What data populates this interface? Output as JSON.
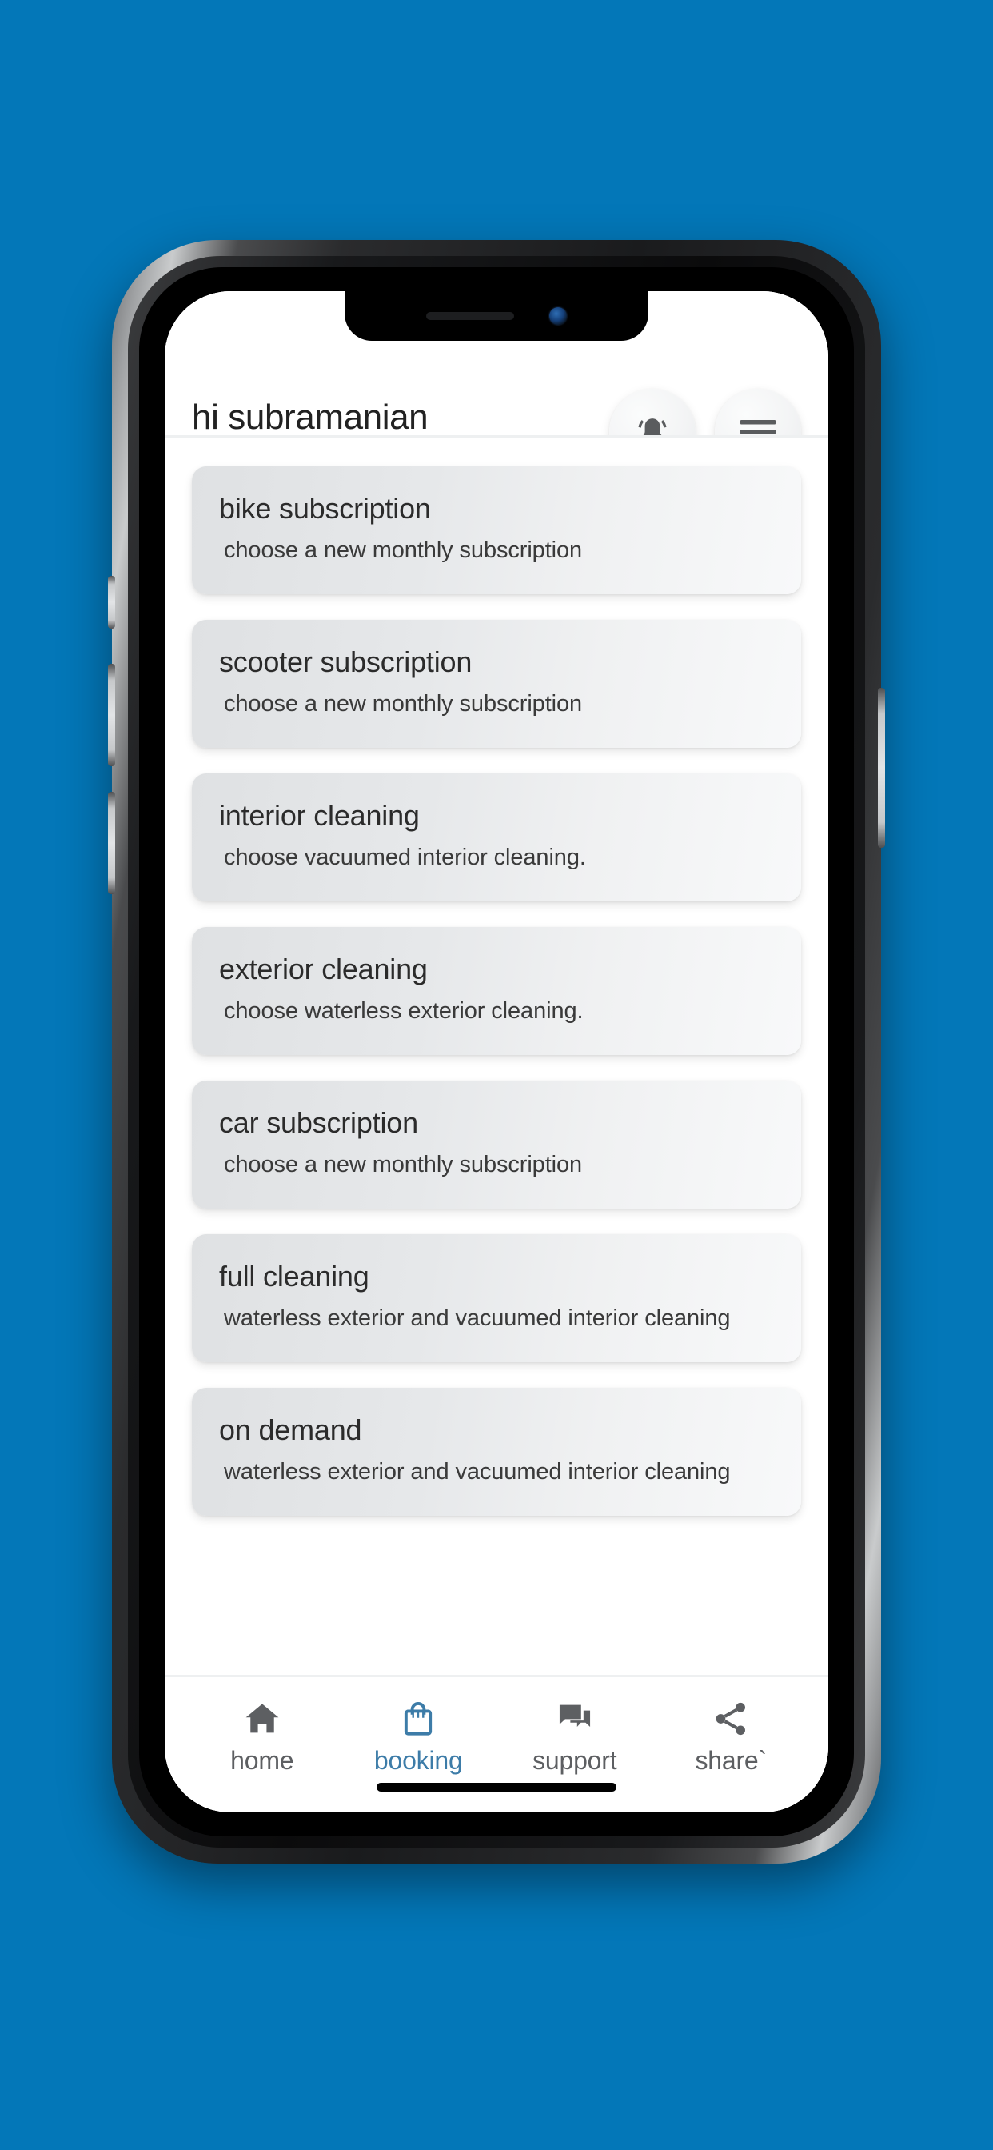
{
  "background": {
    "color": "#0377b8"
  },
  "app": {
    "header": {
      "greeting": "hi subramanian",
      "notification_icon": "bell-icon",
      "menu_icon": "hamburger-menu-icon"
    },
    "cards": [
      {
        "title": "bike subscription",
        "subtitle": "choose a new monthly subscription"
      },
      {
        "title": "scooter subscription",
        "subtitle": "choose a new monthly subscription"
      },
      {
        "title": "interior cleaning",
        "subtitle": "choose vacuumed interior cleaning."
      },
      {
        "title": "exterior cleaning",
        "subtitle": "choose waterless exterior cleaning."
      },
      {
        "title": "car subscription",
        "subtitle": "choose a new monthly subscription"
      },
      {
        "title": "full cleaning",
        "subtitle": "waterless exterior and vacuumed interior cleaning"
      },
      {
        "title": "on demand",
        "subtitle": "waterless exterior and vacuumed interior cleaning"
      }
    ],
    "bottom_nav": {
      "active_color": "#3d7ca8",
      "inactive_color": "#5d5f62",
      "items": [
        {
          "label": "home",
          "icon": "home-icon",
          "active": false
        },
        {
          "label": "booking",
          "icon": "shopping-bag-icon",
          "active": true
        },
        {
          "label": "support",
          "icon": "chat-bubbles-icon",
          "active": false
        },
        {
          "label": "share`",
          "icon": "share-nodes-icon",
          "active": false
        }
      ]
    }
  }
}
